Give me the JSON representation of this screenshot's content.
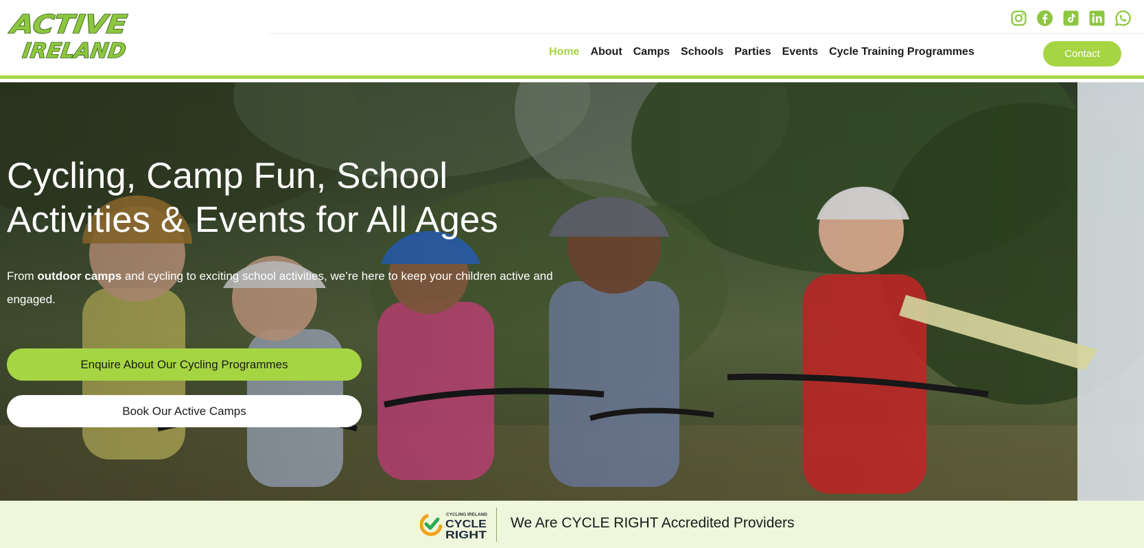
{
  "brand": {
    "logo_line1": "ACTIVE",
    "logo_line2": "IRELAND",
    "accent_color": "#a6d544"
  },
  "socials": [
    {
      "name": "instagram-icon"
    },
    {
      "name": "facebook-icon"
    },
    {
      "name": "tiktok-icon"
    },
    {
      "name": "linkedin-icon"
    },
    {
      "name": "whatsapp-icon"
    }
  ],
  "nav": {
    "items": [
      {
        "label": "Home",
        "active": true
      },
      {
        "label": "About"
      },
      {
        "label": "Camps"
      },
      {
        "label": "Schools"
      },
      {
        "label": "Parties"
      },
      {
        "label": "Events"
      },
      {
        "label": "Cycle Training Programmes"
      }
    ],
    "contact_label": "Contact"
  },
  "hero": {
    "title": "Cycling, Camp Fun, School Activities & Events for All Ages",
    "sub_before": "From ",
    "sub_bold": "outdoor camps",
    "sub_after": " and cycling to exciting school activities, we’re here to keep your children active and engaged.",
    "primary_button": "Enquire About Our Cycling Programmes",
    "secondary_button": "Book Our Active Camps"
  },
  "accreditation": {
    "logo_small": "CYCLING IRELAND",
    "logo_line1": "CYCLE",
    "logo_line2": "RIGHT",
    "text": "We Are CYCLE RIGHT Accredited Providers"
  }
}
